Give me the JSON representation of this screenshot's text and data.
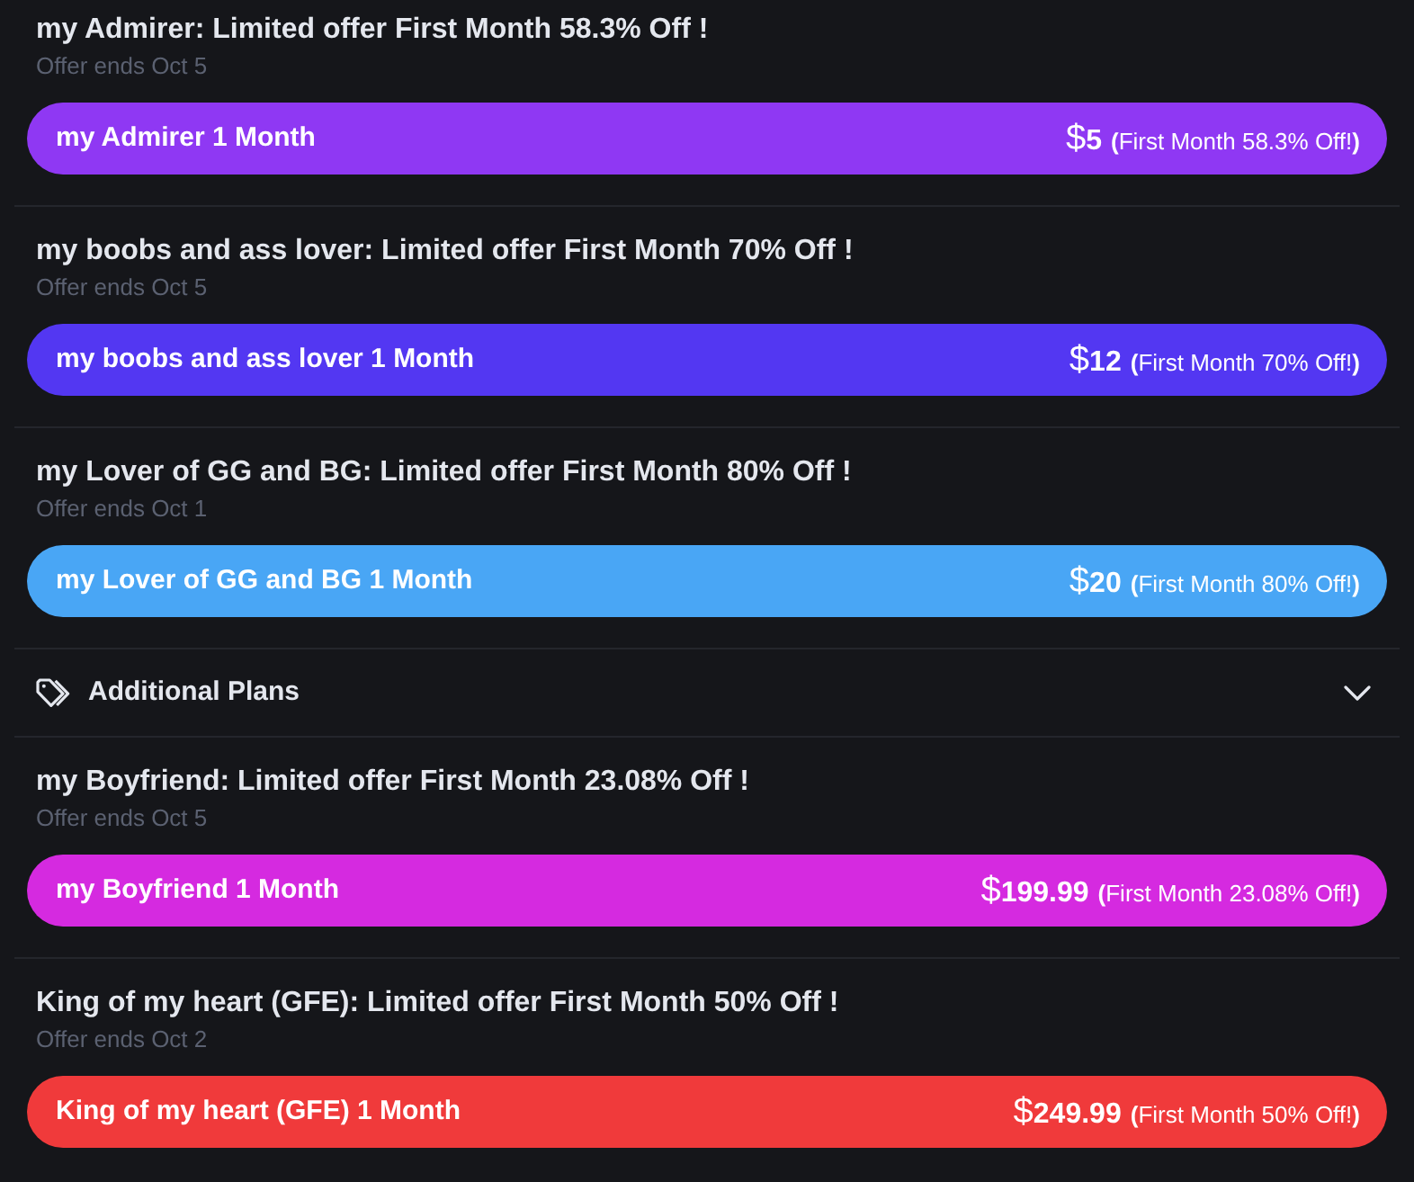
{
  "sections": [
    {
      "kind": "plan",
      "title": "my Admirer: Limited offer First Month 58.3% Off !",
      "ends": "Offer ends Oct 5",
      "plan_name": "my Admirer 1 Month",
      "currency": "$",
      "amount": "5",
      "discount": "**(**First Month 58.3% Off!**)**",
      "color": "#8f38f3"
    },
    {
      "kind": "plan",
      "title": "my boobs and ass lover: Limited offer First Month 70% Off !",
      "ends": "Offer ends Oct 5",
      "plan_name": "my boobs and ass lover 1 Month",
      "currency": "$",
      "amount": "12",
      "discount": "**(**First Month 70% Off!**)**",
      "color": "#5337f2"
    },
    {
      "kind": "plan",
      "title": "my Lover of GG and BG: Limited offer First Month 80% Off !",
      "ends": "Offer ends Oct 1",
      "plan_name": "my Lover of GG and BG 1 Month",
      "currency": "$",
      "amount": "20",
      "discount": "**(**First Month 80% Off!**)**",
      "color": "#49a6f5"
    },
    {
      "kind": "group",
      "label": "Additional Plans",
      "expanded": false
    },
    {
      "kind": "plan",
      "title": "my Boyfriend: Limited offer First Month 23.08% Off !",
      "ends": "Offer ends Oct 5",
      "plan_name": "my Boyfriend 1 Month",
      "currency": "$",
      "amount": "199.99",
      "discount": "**(**First Month 23.08% Off!**)**",
      "color": "#d52ae0"
    },
    {
      "kind": "plan",
      "title": "King of my heart (GFE): Limited offer First Month 50% Off !",
      "ends": "Offer ends Oct 2",
      "plan_name": "King of my heart (GFE) 1 Month",
      "currency": "$",
      "amount": "249.99",
      "discount": "**(**First Month 50% Off!**)**",
      "color": "#f03a3b"
    }
  ]
}
